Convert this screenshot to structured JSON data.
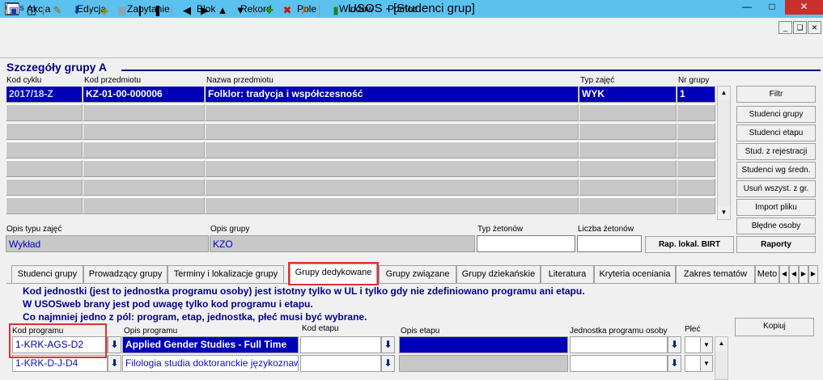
{
  "window": {
    "app_icon": "USOS",
    "title": "USOS - [Studenci grup]"
  },
  "menu": [
    "Akcja",
    "Edycja",
    "Zapytanie",
    "Blok",
    "Rekord",
    "Pole",
    "Window",
    "Pomoc"
  ],
  "section": {
    "title": "Szczegóły grupy  A"
  },
  "group": {
    "columns": [
      "Kod cyklu",
      "Kod przedmiotu",
      "Nazwa przedmiotu",
      "Typ zajęć",
      "Nr grupy"
    ],
    "row": [
      "2017/18-Z",
      "KZ-01-00-000006",
      "Folklor: tradycja i współczesność",
      "WYK",
      "1"
    ]
  },
  "details": {
    "opis_typu_label": "Opis typu zajęć",
    "opis_typu_value": "Wykład",
    "opis_grupy_label": "Opis grupy",
    "opis_grupy_value": "KZO",
    "typ_zetonow_label": "Typ żetonów",
    "liczba_zetonow_label": "Liczba żetonów",
    "rap_button": "Rap. lokal. BIRT"
  },
  "side_buttons": [
    "Filtr",
    "Studenci grupy",
    "Studenci etapu",
    "Stud. z rejestracji",
    "Studenci wg średn.",
    "Usuń wszyst. z gr.",
    "Import pliku",
    "Błędne osoby",
    "Raporty"
  ],
  "tabs": [
    "Studenci grupy",
    "Prowadzący grupy",
    "Terminy i lokalizacje grupy",
    "Grupy dedykowane",
    "Grupy związane",
    "Grupy dziekańskie",
    "Literatura",
    "Kryteria oceniania",
    "Zakres tematów",
    "Meto"
  ],
  "info_lines": [
    "Kod jednostki (jest to jednostka programu osoby) jest istotny tylko w UL i tylko gdy nie zdefiniowano programu ani etapu.",
    "W USOSweb brany jest pod uwagę tylko kod programu i etapu.",
    "Co najmniej jedno z pól: program, etap, jednostka, płeć musi być wybrane."
  ],
  "dedicated": {
    "columns": [
      "Kod programu",
      "Opis programu",
      "Kod etapu",
      "Opis etapu",
      "Jednostka programu osoby",
      "Płeć"
    ],
    "rows": [
      {
        "kod": "1-KRK-AGS-D2",
        "opis": "Applied Gender Studies - Full Time"
      },
      {
        "kod": "1-KRK-D-J-D4",
        "opis": "Filologia studia doktoranckie językoznawstwo"
      }
    ],
    "copy_button": "Kopiuj"
  }
}
